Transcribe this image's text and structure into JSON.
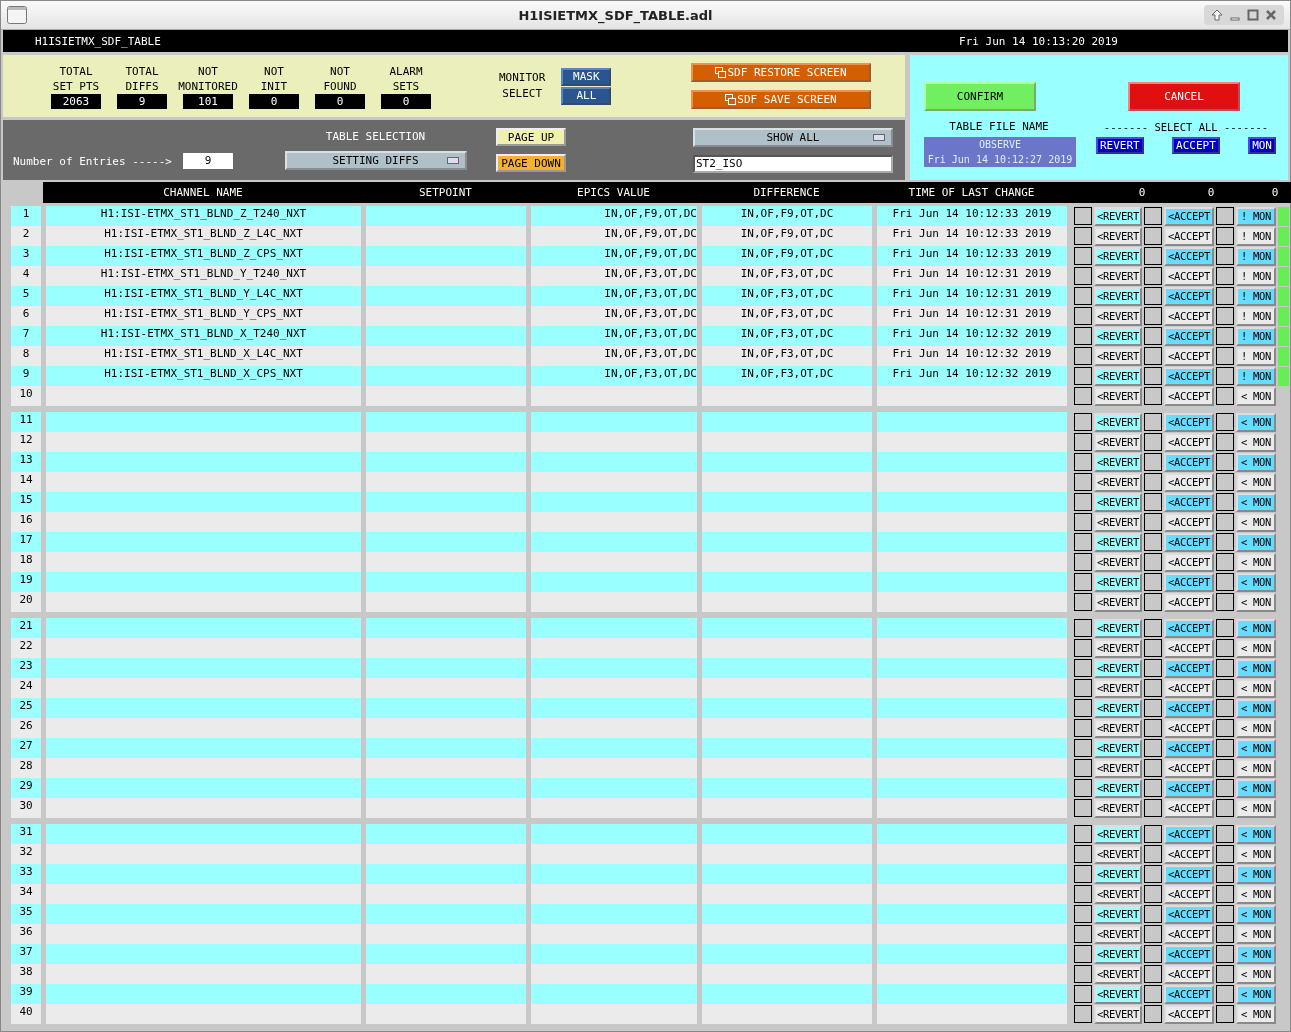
{
  "window": {
    "title": "H1ISIETMX_SDF_TABLE.adl"
  },
  "header": {
    "name": "H1ISIETMX_SDF_TABLE",
    "clock": "Fri Jun 14 10:13:20 2019"
  },
  "stats": [
    {
      "label": [
        "TOTAL",
        "SET PTS"
      ],
      "value": "2063"
    },
    {
      "label": [
        "TOTAL",
        "DIFFS"
      ],
      "value": "9"
    },
    {
      "label": [
        "NOT",
        "MONITORED"
      ],
      "value": "101"
    },
    {
      "label": [
        "NOT",
        "INIT"
      ],
      "value": "0"
    },
    {
      "label": [
        "NOT",
        "FOUND"
      ],
      "value": "0"
    },
    {
      "label": [
        "ALARM",
        "SETS"
      ],
      "value": "0"
    }
  ],
  "monitor_select": {
    "label": [
      "MONITOR",
      "SELECT"
    ],
    "buttons": [
      "MASK",
      "ALL"
    ]
  },
  "screen_buttons": [
    "SDF RESTORE SCREEN",
    "SDF SAVE SCREEN"
  ],
  "table_selection": {
    "label": "TABLE SELECTION",
    "entries_label": "Number of Entries ----->",
    "entries": "9",
    "menu": "SETTING DIFFS"
  },
  "paging": {
    "page_up": "PAGE UP",
    "page_down": "PAGE DOWN"
  },
  "filter": {
    "menu": "SHOW ALL",
    "value": "ST2_ISO"
  },
  "file_panel": {
    "confirm": "CONFIRM",
    "cancel": "CANCEL",
    "label": "TABLE FILE NAME",
    "file": "OBSERVE",
    "file_time": "Fri Jun 14 10:12:27 2019",
    "select_all": "------- SELECT ALL -------",
    "buttons": [
      "REVERT",
      "ACCEPT",
      "MON"
    ]
  },
  "table": {
    "columns": [
      "CHANNEL NAME",
      "SETPOINT",
      "EPICS VALUE",
      "DIFFERENCE",
      "TIME OF LAST CHANGE"
    ],
    "counts": [
      "0",
      "0",
      "0"
    ],
    "rows": [
      {
        "n": "1",
        "channel": "H1:ISI-ETMX_ST1_BLND_Z_T240_NXT",
        "epics": "IN,OF,F9,OT,DC",
        "difference": "IN,OF,F9,OT,DC",
        "time": "Fri Jun 14 10:12:33 2019",
        "revert": "<REVERT",
        "accept": "<ACCEPT",
        "mon": "! MON",
        "revert_checked": false,
        "accept_checked": false,
        "mon_checked": false,
        "diff": true
      },
      {
        "n": "2",
        "channel": "H1:ISI-ETMX_ST1_BLND_Z_L4C_NXT",
        "epics": "IN,OF,F9,OT,DC",
        "difference": "IN,OF,F9,OT,DC",
        "time": "Fri Jun 14 10:12:33 2019",
        "revert": "<REVERT",
        "accept": "<ACCEPT",
        "mon": "! MON",
        "revert_checked": false,
        "accept_checked": false,
        "mon_checked": false,
        "diff": true
      },
      {
        "n": "3",
        "channel": "H1:ISI-ETMX_ST1_BLND_Z_CPS_NXT",
        "epics": "IN,OF,F9,OT,DC",
        "difference": "IN,OF,F9,OT,DC",
        "time": "Fri Jun 14 10:12:33 2019",
        "revert": "<REVERT",
        "accept": "<ACCEPT",
        "mon": "! MON",
        "revert_checked": false,
        "accept_checked": false,
        "mon_checked": false,
        "diff": true
      },
      {
        "n": "4",
        "channel": "H1:ISI-ETMX_ST1_BLND_Y_T240_NXT",
        "epics": "IN,OF,F3,OT,DC",
        "difference": "IN,OF,F3,OT,DC",
        "time": "Fri Jun 14 10:12:31 2019",
        "revert": "<REVERT",
        "accept": "<ACCEPT",
        "mon": "! MON",
        "revert_checked": false,
        "accept_checked": false,
        "mon_checked": false,
        "diff": true
      },
      {
        "n": "5",
        "channel": "H1:ISI-ETMX_ST1_BLND_Y_L4C_NXT",
        "epics": "IN,OF,F3,OT,DC",
        "difference": "IN,OF,F3,OT,DC",
        "time": "Fri Jun 14 10:12:31 2019",
        "revert": "<REVERT",
        "accept": "<ACCEPT",
        "mon": "! MON",
        "revert_checked": false,
        "accept_checked": false,
        "mon_checked": false,
        "diff": true
      },
      {
        "n": "6",
        "channel": "H1:ISI-ETMX_ST1_BLND_Y_CPS_NXT",
        "epics": "IN,OF,F3,OT,DC",
        "difference": "IN,OF,F3,OT,DC",
        "time": "Fri Jun 14 10:12:31 2019",
        "revert": "<REVERT",
        "accept": "<ACCEPT",
        "mon": "! MON",
        "revert_checked": false,
        "accept_checked": false,
        "mon_checked": false,
        "diff": true
      },
      {
        "n": "7",
        "channel": "H1:ISI-ETMX_ST1_BLND_X_T240_NXT",
        "epics": "IN,OF,F3,OT,DC",
        "difference": "IN,OF,F3,OT,DC",
        "time": "Fri Jun 14 10:12:32 2019",
        "revert": "<REVERT",
        "accept": "<ACCEPT",
        "mon": "! MON",
        "revert_checked": false,
        "accept_checked": false,
        "mon_checked": false,
        "diff": true
      },
      {
        "n": "8",
        "channel": "H1:ISI-ETMX_ST1_BLND_X_L4C_NXT",
        "epics": "IN,OF,F3,OT,DC",
        "difference": "IN,OF,F3,OT,DC",
        "time": "Fri Jun 14 10:12:32 2019",
        "revert": "<REVERT",
        "accept": "<ACCEPT",
        "mon": "! MON",
        "revert_checked": false,
        "accept_checked": false,
        "mon_checked": false,
        "diff": true
      },
      {
        "n": "9",
        "channel": "H1:ISI-ETMX_ST1_BLND_X_CPS_NXT",
        "epics": "IN,OF,F3,OT,DC",
        "difference": "IN,OF,F3,OT,DC",
        "time": "Fri Jun 14 10:12:32 2019",
        "revert": "<REVERT",
        "accept": "<ACCEPT",
        "mon": "! MON",
        "revert_checked": false,
        "accept_checked": false,
        "mon_checked": false,
        "diff": true
      },
      {
        "n": "10",
        "revert": "<REVERT",
        "accept": "<ACCEPT",
        "mon": "< MON",
        "revert_checked": false,
        "accept_checked": false,
        "mon_checked": false,
        "diff": false
      },
      {
        "n": "11",
        "revert": "<REVERT",
        "accept": "<ACCEPT",
        "mon": "< MON",
        "revert_checked": false,
        "accept_checked": false,
        "mon_checked": false,
        "diff": false
      },
      {
        "n": "12",
        "revert": "<REVERT",
        "accept": "<ACCEPT",
        "mon": "< MON",
        "revert_checked": false,
        "accept_checked": false,
        "mon_checked": false,
        "diff": false
      },
      {
        "n": "13",
        "revert": "<REVERT",
        "accept": "<ACCEPT",
        "mon": "< MON",
        "revert_checked": false,
        "accept_checked": false,
        "mon_checked": false,
        "diff": false
      },
      {
        "n": "14",
        "revert": "<REVERT",
        "accept": "<ACCEPT",
        "mon": "< MON",
        "revert_checked": false,
        "accept_checked": false,
        "mon_checked": false,
        "diff": false
      },
      {
        "n": "15",
        "revert": "<REVERT",
        "accept": "<ACCEPT",
        "mon": "< MON",
        "revert_checked": false,
        "accept_checked": false,
        "mon_checked": false,
        "diff": false
      },
      {
        "n": "16",
        "revert": "<REVERT",
        "accept": "<ACCEPT",
        "mon": "< MON",
        "revert_checked": false,
        "accept_checked": false,
        "mon_checked": false,
        "diff": false
      },
      {
        "n": "17",
        "revert": "<REVERT",
        "accept": "<ACCEPT",
        "mon": "< MON",
        "revert_checked": false,
        "accept_checked": false,
        "mon_checked": false,
        "diff": false
      },
      {
        "n": "18",
        "revert": "<REVERT",
        "accept": "<ACCEPT",
        "mon": "< MON",
        "revert_checked": false,
        "accept_checked": false,
        "mon_checked": false,
        "diff": false
      },
      {
        "n": "19",
        "revert": "<REVERT",
        "accept": "<ACCEPT",
        "mon": "< MON",
        "revert_checked": false,
        "accept_checked": false,
        "mon_checked": false,
        "diff": false
      },
      {
        "n": "20",
        "revert": "<REVERT",
        "accept": "<ACCEPT",
        "mon": "< MON",
        "revert_checked": false,
        "accept_checked": false,
        "mon_checked": false,
        "diff": false
      },
      {
        "n": "21",
        "revert": "<REVERT",
        "accept": "<ACCEPT",
        "mon": "< MON",
        "revert_checked": false,
        "accept_checked": false,
        "mon_checked": false,
        "diff": false
      },
      {
        "n": "22",
        "revert": "<REVERT",
        "accept": "<ACCEPT",
        "mon": "< MON",
        "revert_checked": false,
        "accept_checked": false,
        "mon_checked": false,
        "diff": false
      },
      {
        "n": "23",
        "revert": "<REVERT",
        "accept": "<ACCEPT",
        "mon": "< MON",
        "revert_checked": false,
        "accept_checked": false,
        "mon_checked": false,
        "diff": false
      },
      {
        "n": "24",
        "revert": "<REVERT",
        "accept": "<ACCEPT",
        "mon": "< MON",
        "revert_checked": false,
        "accept_checked": false,
        "mon_checked": false,
        "diff": false
      },
      {
        "n": "25",
        "revert": "<REVERT",
        "accept": "<ACCEPT",
        "mon": "< MON",
        "revert_checked": false,
        "accept_checked": false,
        "mon_checked": false,
        "diff": false
      },
      {
        "n": "26",
        "revert": "<REVERT",
        "accept": "<ACCEPT",
        "mon": "< MON",
        "revert_checked": false,
        "accept_checked": false,
        "mon_checked": false,
        "diff": false
      },
      {
        "n": "27",
        "revert": "<REVERT",
        "accept": "<ACCEPT",
        "mon": "< MON",
        "revert_checked": false,
        "accept_checked": false,
        "mon_checked": false,
        "diff": false
      },
      {
        "n": "28",
        "revert": "<REVERT",
        "accept": "<ACCEPT",
        "mon": "< MON",
        "revert_checked": false,
        "accept_checked": false,
        "mon_checked": false,
        "diff": false
      },
      {
        "n": "29",
        "revert": "<REVERT",
        "accept": "<ACCEPT",
        "mon": "< MON",
        "revert_checked": false,
        "accept_checked": false,
        "mon_checked": false,
        "diff": false
      },
      {
        "n": "30",
        "revert": "<REVERT",
        "accept": "<ACCEPT",
        "mon": "< MON",
        "revert_checked": false,
        "accept_checked": false,
        "mon_checked": false,
        "diff": false
      },
      {
        "n": "31",
        "revert": "<REVERT",
        "accept": "<ACCEPT",
        "mon": "< MON",
        "revert_checked": false,
        "accept_checked": false,
        "mon_checked": false,
        "diff": false
      },
      {
        "n": "32",
        "revert": "<REVERT",
        "accept": "<ACCEPT",
        "mon": "< MON",
        "revert_checked": false,
        "accept_checked": false,
        "mon_checked": false,
        "diff": false
      },
      {
        "n": "33",
        "revert": "<REVERT",
        "accept": "<ACCEPT",
        "mon": "< MON",
        "revert_checked": false,
        "accept_checked": false,
        "mon_checked": false,
        "diff": false
      },
      {
        "n": "34",
        "revert": "<REVERT",
        "accept": "<ACCEPT",
        "mon": "< MON",
        "revert_checked": false,
        "accept_checked": false,
        "mon_checked": false,
        "diff": false
      },
      {
        "n": "35",
        "revert": "<REVERT",
        "accept": "<ACCEPT",
        "mon": "< MON",
        "revert_checked": false,
        "accept_checked": false,
        "mon_checked": false,
        "diff": false
      },
      {
        "n": "36",
        "revert": "<REVERT",
        "accept": "<ACCEPT",
        "mon": "< MON",
        "revert_checked": false,
        "accept_checked": false,
        "mon_checked": false,
        "diff": false
      },
      {
        "n": "37",
        "revert": "<REVERT",
        "accept": "<ACCEPT",
        "mon": "< MON",
        "revert_checked": false,
        "accept_checked": false,
        "mon_checked": false,
        "diff": false
      },
      {
        "n": "38",
        "revert": "<REVERT",
        "accept": "<ACCEPT",
        "mon": "< MON",
        "revert_checked": false,
        "accept_checked": false,
        "mon_checked": false,
        "diff": false
      },
      {
        "n": "39",
        "revert": "<REVERT",
        "accept": "<ACCEPT",
        "mon": "< MON",
        "revert_checked": false,
        "accept_checked": false,
        "mon_checked": false,
        "diff": false
      },
      {
        "n": "40",
        "revert": "<REVERT",
        "accept": "<ACCEPT",
        "mon": "< MON",
        "revert_checked": false,
        "accept_checked": false,
        "mon_checked": false,
        "diff": false
      }
    ]
  }
}
